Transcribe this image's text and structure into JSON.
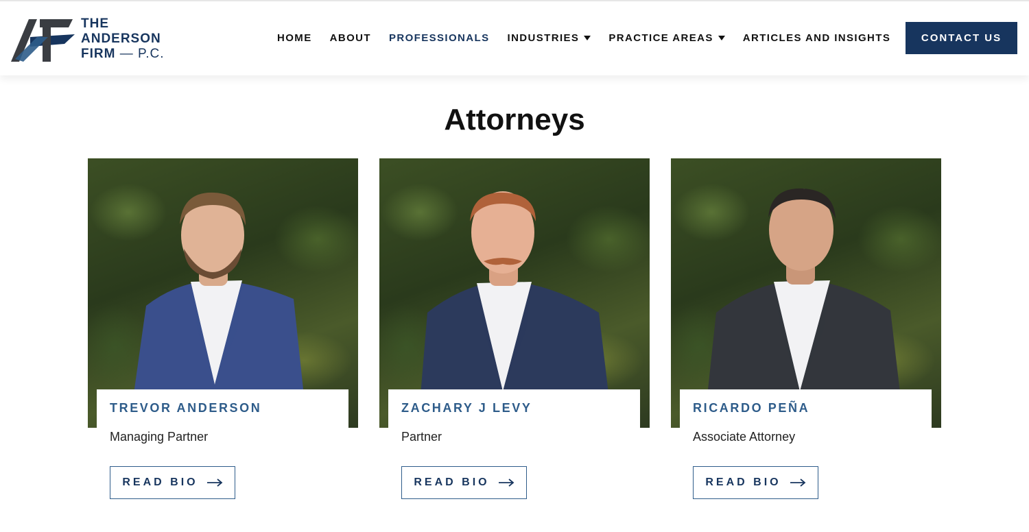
{
  "brand": {
    "line1": "THE",
    "line2": "ANDERSON",
    "line3": "FIRM",
    "line3_suffix": "— P.C.",
    "logo_icon": "af-monogram-icon",
    "primary_color": "#17355e",
    "accent_color": "#2e5c8a"
  },
  "nav": {
    "items": [
      {
        "label": "HOME",
        "dropdown": false,
        "active": false
      },
      {
        "label": "ABOUT",
        "dropdown": false,
        "active": false
      },
      {
        "label": "PROFESSIONALS",
        "dropdown": false,
        "active": true
      },
      {
        "label": "INDUSTRIES",
        "dropdown": true,
        "active": false
      },
      {
        "label": "PRACTICE AREAS",
        "dropdown": true,
        "active": false
      },
      {
        "label": "ARTICLES AND INSIGHTS",
        "dropdown": false,
        "active": false
      }
    ],
    "contact_label": "CONTACT US"
  },
  "page": {
    "title": "Attorneys"
  },
  "attorneys": [
    {
      "name": "TREVOR ANDERSON",
      "role": "Managing Partner",
      "button_label": "READ BIO",
      "suit_color": "#3a4f8c",
      "hair_color": "#7a5a3a"
    },
    {
      "name": "ZACHARY J LEVY",
      "role": "Partner",
      "button_label": "READ BIO",
      "suit_color": "#2c3a5c",
      "hair_color": "#b0623a"
    },
    {
      "name": "RICARDO PEÑA",
      "role": "Associate Attorney",
      "button_label": "READ BIO",
      "suit_color": "#33363c",
      "hair_color": "#2a2624"
    }
  ]
}
